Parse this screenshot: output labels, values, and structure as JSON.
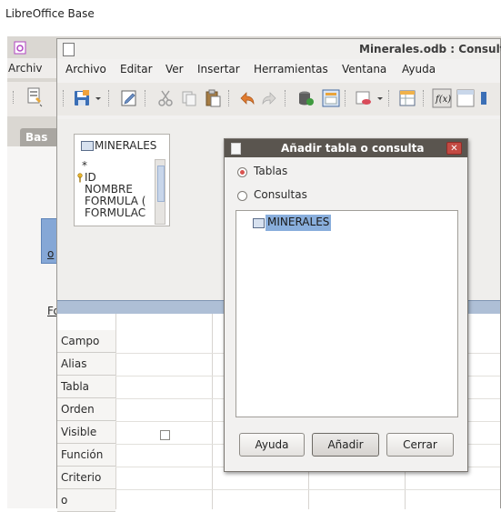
{
  "caption": "LibreOffice Base",
  "background": {
    "menu_fragment": "Archiv",
    "tab_fragment": "Bas",
    "link_fragment_1": "Fo",
    "link_fragment_2": "o"
  },
  "query_window": {
    "title": "Minerales.odb : Consulta",
    "menu": [
      "Archivo",
      "Editar",
      "Ver",
      "Insertar",
      "Herramientas",
      "Ventana",
      "Ayuda"
    ],
    "table": {
      "name": "MINERALES",
      "fields": [
        "*",
        "ID",
        "NOMBRE",
        "FORMULA (",
        "FORMULAC"
      ]
    },
    "grid_rows": [
      "Campo",
      "Alias",
      "Tabla",
      "Orden",
      "Visible",
      "Función",
      "Criterio",
      "o"
    ]
  },
  "dialog": {
    "title": "Añadir tabla o consulta",
    "options": {
      "tables": "Tablas",
      "queries": "Consultas",
      "selected": "Tablas"
    },
    "list_items": [
      "MINERALES"
    ],
    "buttons": {
      "help": "Ayuda",
      "add": "Añadir",
      "close": "Cerrar"
    }
  },
  "colors": {
    "accent_selection": "#89aedc",
    "dialog_titlebar": "#5a554f",
    "close_button": "#c34a43",
    "radio_selected": "#d9534f"
  }
}
